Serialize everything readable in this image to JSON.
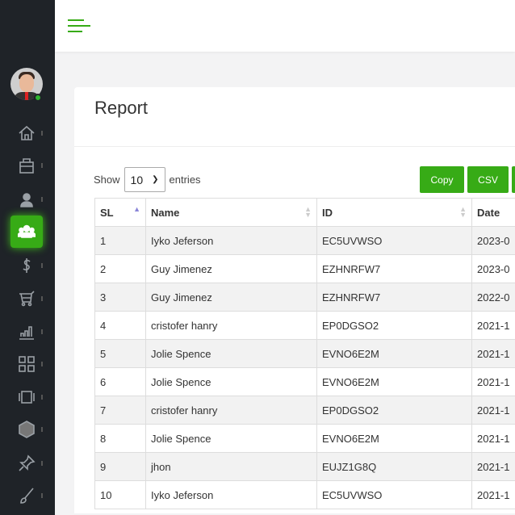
{
  "header": {
    "menu_icon": "hamburger-icon"
  },
  "sidebar": {
    "items": [
      {
        "icon": "home-icon"
      },
      {
        "icon": "briefcase-icon"
      },
      {
        "icon": "user-icon"
      },
      {
        "icon": "users-icon",
        "active": true
      },
      {
        "icon": "dollar-icon"
      },
      {
        "icon": "cart-icon"
      },
      {
        "icon": "bar-chart-icon"
      },
      {
        "icon": "grid-icon"
      },
      {
        "icon": "carousel-icon"
      },
      {
        "icon": "hexagon-icon"
      },
      {
        "icon": "pin-icon"
      },
      {
        "icon": "brush-icon"
      }
    ],
    "accent": "#37ab16"
  },
  "page": {
    "title": "Report"
  },
  "controls": {
    "show": "Show",
    "entries_value": "10",
    "entries": "entries",
    "copy": "Copy",
    "csv": "CSV"
  },
  "table": {
    "columns": [
      "SL",
      "Name",
      "ID",
      "Date"
    ],
    "rows": [
      [
        "1",
        "Iyko Jeferson",
        "EC5UVWSO",
        "2023-0"
      ],
      [
        "2",
        "Guy Jimenez",
        "EZHNRFW7",
        "2023-0"
      ],
      [
        "3",
        "Guy Jimenez",
        "EZHNRFW7",
        "2022-0"
      ],
      [
        "4",
        "cristofer hanry",
        "EP0DGSO2",
        "2021-1"
      ],
      [
        "5",
        "Jolie Spence",
        "EVNO6E2M",
        "2021-1"
      ],
      [
        "6",
        "Jolie Spence",
        "EVNO6E2M",
        "2021-1"
      ],
      [
        "7",
        "cristofer hanry",
        "EP0DGSO2",
        "2021-1"
      ],
      [
        "8",
        "Jolie Spence",
        "EVNO6E2M",
        "2021-1"
      ],
      [
        "9",
        "jhon",
        "EUJZ1G8Q",
        "2021-1"
      ],
      [
        "10",
        "Iyko Jeferson",
        "EC5UVWSO",
        "2021-1"
      ]
    ]
  }
}
